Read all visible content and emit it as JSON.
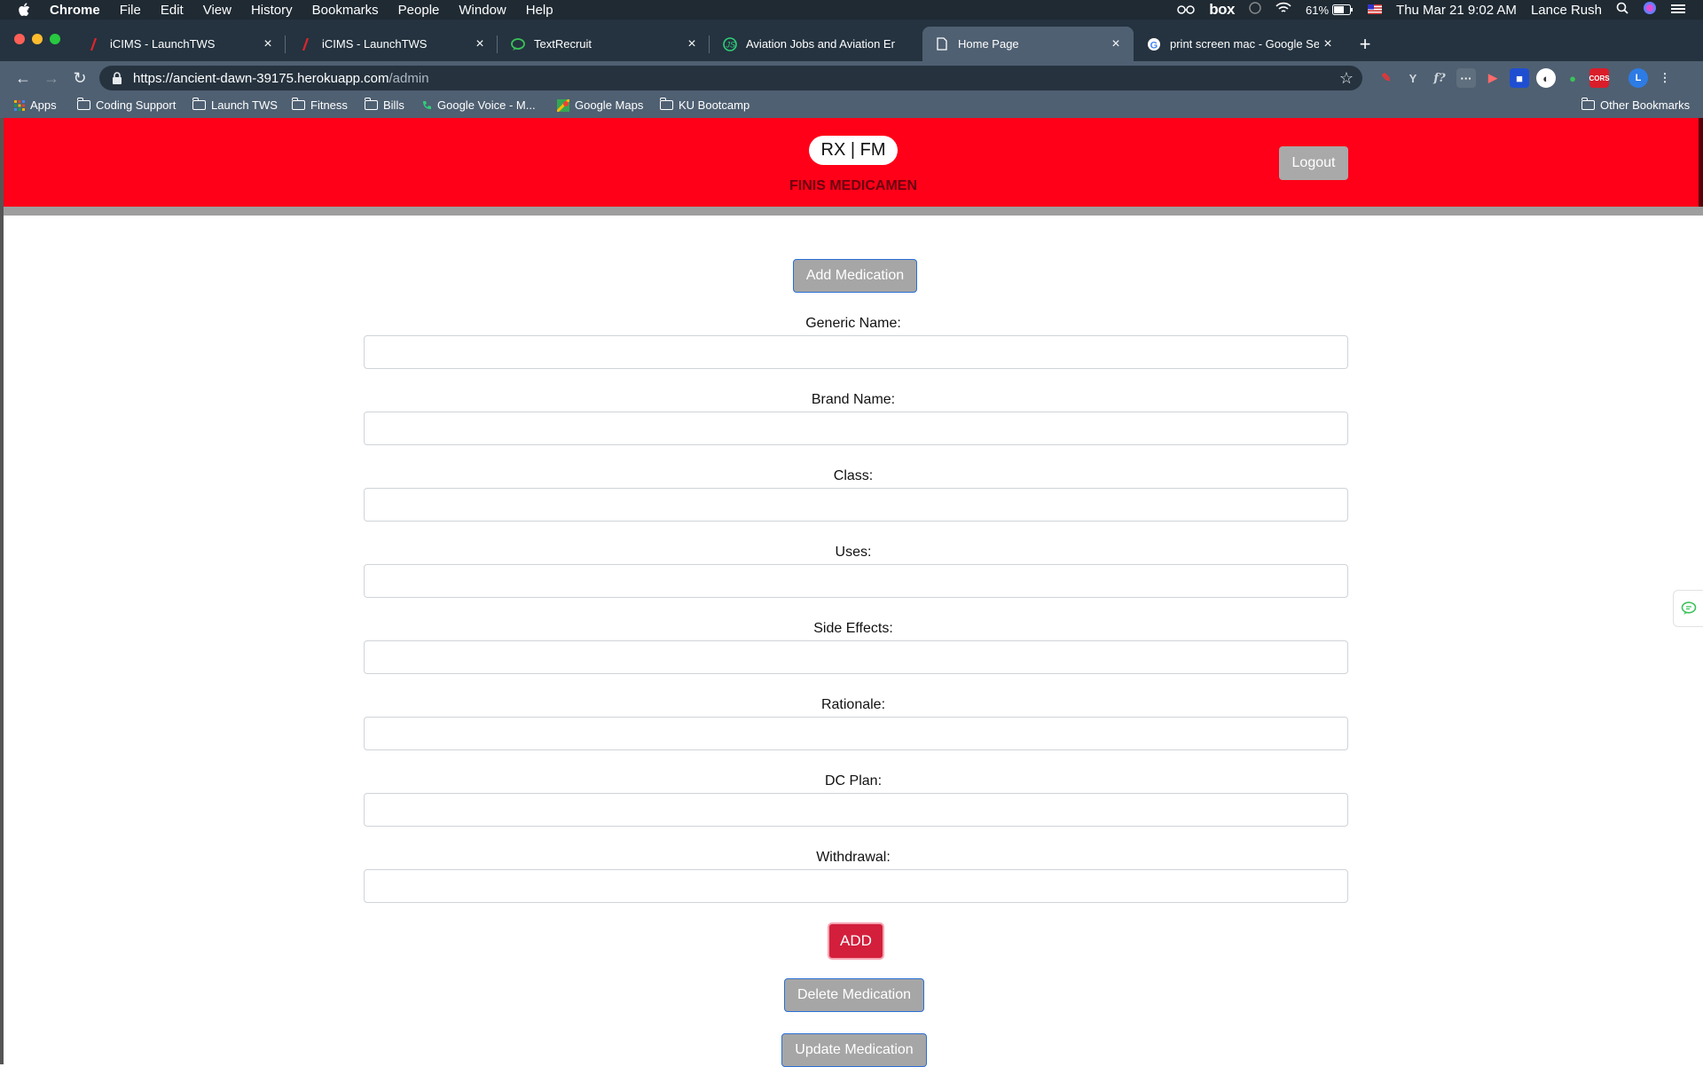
{
  "menubar": {
    "app": "Chrome",
    "items": [
      "File",
      "Edit",
      "View",
      "History",
      "Bookmarks",
      "People",
      "Window",
      "Help"
    ],
    "box_label": "box",
    "battery": "61%",
    "datetime": "Thu Mar 21  9:02 AM",
    "user": "Lance Rush"
  },
  "tabs": [
    {
      "title": "iCIMS - LaunchTWS",
      "favicon": "icims-icon"
    },
    {
      "title": "iCIMS - LaunchTWS",
      "favicon": "icims-icon"
    },
    {
      "title": "TextRecruit",
      "favicon": "chat-icon"
    },
    {
      "title": "Aviation Jobs and Aviation Emp",
      "favicon": "js-icon"
    },
    {
      "title": "Home Page",
      "favicon": "page-icon",
      "active": true
    },
    {
      "title": "print screen mac - Google Sea",
      "favicon": "google-icon"
    }
  ],
  "toolbar": {
    "url_host": "https://ancient-dawn-39175.herokuapp.com",
    "url_path": "/admin"
  },
  "bookmarks": {
    "apps": "Apps",
    "items": [
      "Coding Support",
      "Launch TWS",
      "Fitness",
      "Bills",
      "Google Voice - M...",
      "Google Maps",
      "KU Bootcamp"
    ],
    "other": "Other Bookmarks"
  },
  "header": {
    "logo": "RX | FM",
    "subtitle": "FINIS MEDICAMEN",
    "logout": "Logout",
    "colors": {
      "header_bg": "#ff0018",
      "band": "#9e9e9e"
    }
  },
  "form": {
    "add_medication": "Add Medication",
    "fields": [
      {
        "label": "Generic Name:",
        "value": ""
      },
      {
        "label": "Brand Name:",
        "value": ""
      },
      {
        "label": "Class:",
        "value": ""
      },
      {
        "label": "Uses:",
        "value": ""
      },
      {
        "label": "Side Effects:",
        "value": ""
      },
      {
        "label": "Rationale:",
        "value": ""
      },
      {
        "label": "DC Plan:",
        "value": ""
      },
      {
        "label": "Withdrawal:",
        "value": ""
      }
    ],
    "add_button": "ADD",
    "delete_medication": "Delete Medication",
    "update_medication": "Update Medication",
    "colors": {
      "add_button": "#d31f3c",
      "secondary_button": "#a6a6a6"
    }
  }
}
